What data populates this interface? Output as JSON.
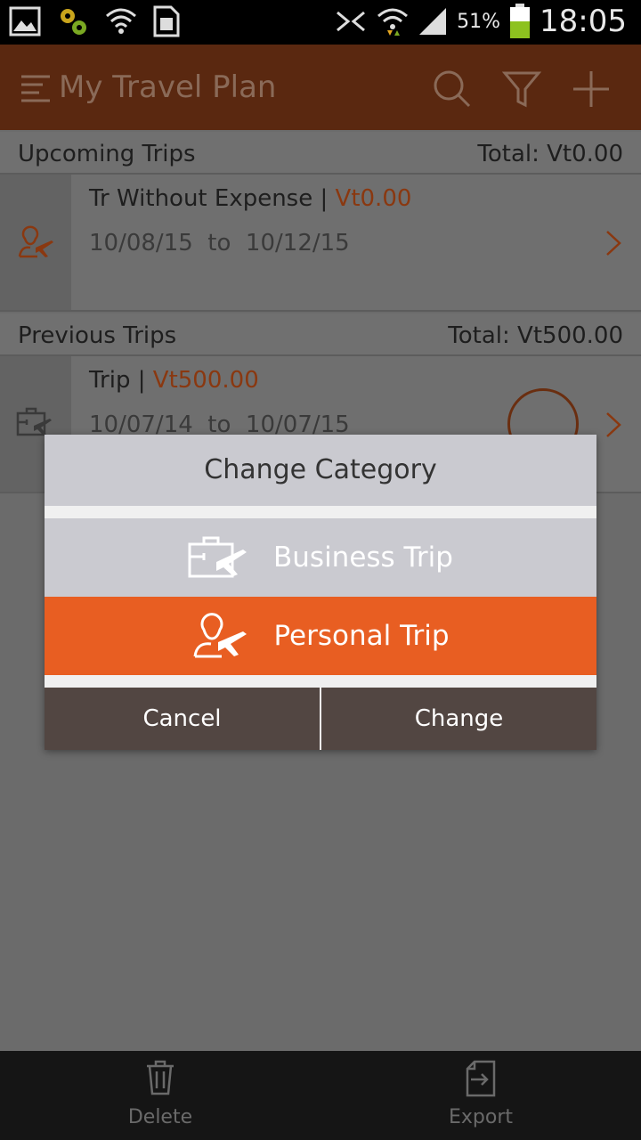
{
  "status_bar": {
    "battery_percent": "51%",
    "time": "18:05"
  },
  "app_bar": {
    "title": "My Travel Plan",
    "icons": [
      "menu-icon",
      "search-icon",
      "filter-icon",
      "add-icon"
    ]
  },
  "upcoming": {
    "label": "Upcoming Trips",
    "total": "Total: Vt0.00",
    "trips": [
      {
        "name": "Tr Without Expense",
        "separator": " | ",
        "amount": "Vt0.00",
        "dates": "10/08/15  to  10/12/15",
        "category_icon": "personal-trip-icon"
      }
    ]
  },
  "previous": {
    "label": "Previous Trips",
    "total": "Total: Vt500.00",
    "trips": [
      {
        "name": "Trip",
        "separator": " | ",
        "amount": "Vt500.00",
        "dates": "10/07/14  to  10/07/15",
        "category_icon": "business-trip-icon"
      }
    ]
  },
  "dialog": {
    "title": "Change Category",
    "options": [
      {
        "label": "Business Trip",
        "icon": "business-trip-icon",
        "selected": false
      },
      {
        "label": "Personal Trip",
        "icon": "personal-trip-icon",
        "selected": true
      }
    ],
    "cancel_label": "Cancel",
    "change_label": "Change"
  },
  "bottom_bar": {
    "delete_label": "Delete",
    "export_label": "Export"
  },
  "colors": {
    "accent": "#e85e22",
    "app_bar": "#5a2810",
    "dialog_buttons": "#524642"
  }
}
